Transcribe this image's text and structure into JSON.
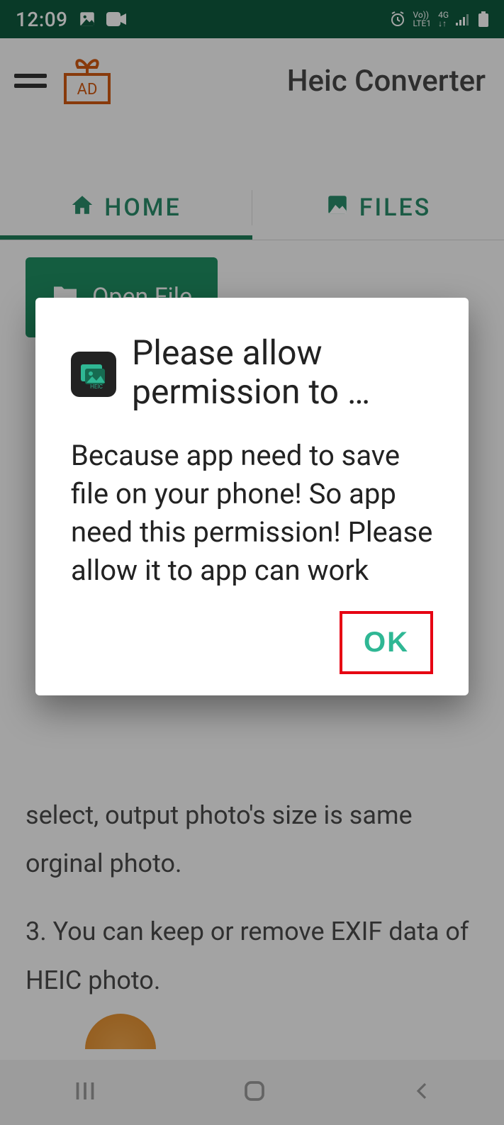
{
  "status": {
    "time": "12:09",
    "net_label": "Vo))",
    "net_sub": "LTE1",
    "net_type": "4G"
  },
  "header": {
    "title": "Heic Converter",
    "ad_label": "AD"
  },
  "tabs": {
    "home": "HOME",
    "files": "FILES"
  },
  "content": {
    "open_button": "Open File",
    "body_excerpt": "select, output photo's size is same orginal photo.",
    "body_line3": "3. You can keep or remove EXIF data of HEIC photo."
  },
  "dialog": {
    "title": "Please allow permission to …",
    "body": "Because app need to save file on your phone! So app need this permission! Please allow it to app can work",
    "ok": "OK",
    "icon_badge": "HEIC"
  }
}
